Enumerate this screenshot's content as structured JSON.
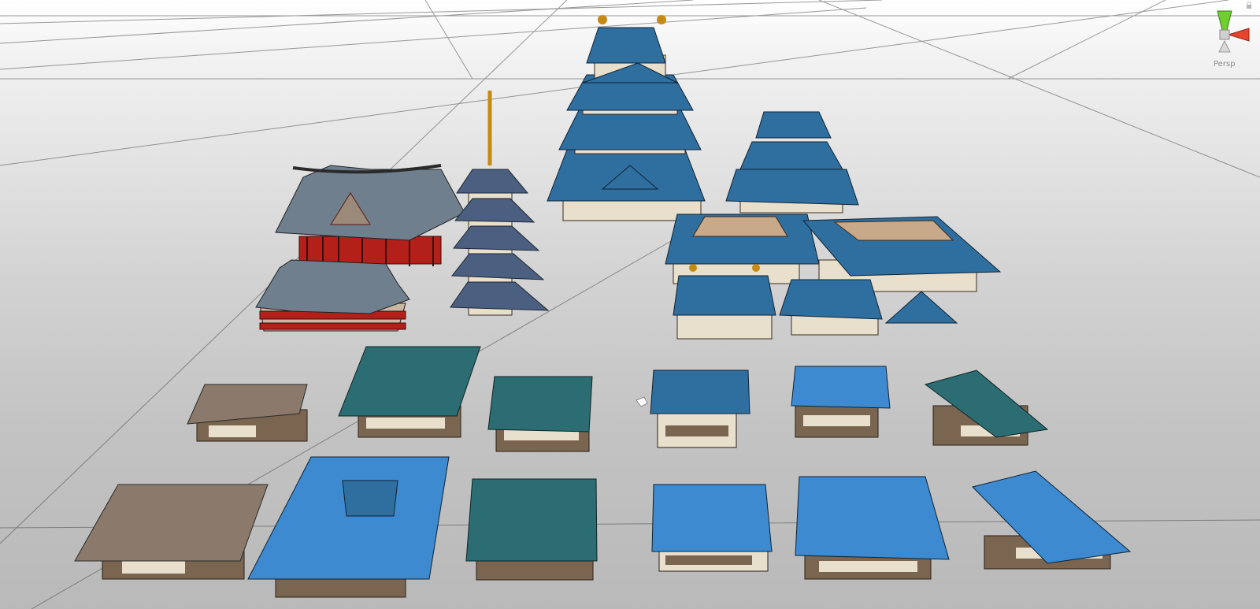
{
  "viewport": {
    "projection_label": "Persp",
    "scene_objects": [
      "pagoda-temple-red-hall",
      "pagoda-temple-red-pavilion",
      "five-story-pagoda",
      "main-castle-keep",
      "small-castle-keep",
      "castle-wing-hall-left",
      "castle-wing-hall-right",
      "castle-gate-tower",
      "castle-annex-building",
      "castle-small-gable",
      "house-row1-1",
      "house-row1-2",
      "house-row1-3",
      "house-row1-4",
      "house-row1-5",
      "house-row1-6",
      "house-row2-1",
      "house-row2-2",
      "house-row2-3",
      "house-row2-4",
      "house-row2-5",
      "house-row2-6"
    ]
  },
  "colors": {
    "roof_slate": "#6f7f8d",
    "roof_blue": "#2f6f9f",
    "roof_bright_blue": "#3d8ad0",
    "roof_teal": "#2c6c73",
    "roof_brown": "#8b7a6b",
    "temple_red": "#b3201a",
    "wall_cream": "#e8e0cc",
    "wood_dark": "#5c4632",
    "gizmo_y": "#6fcf2f",
    "gizmo_x": "#e8442c"
  }
}
